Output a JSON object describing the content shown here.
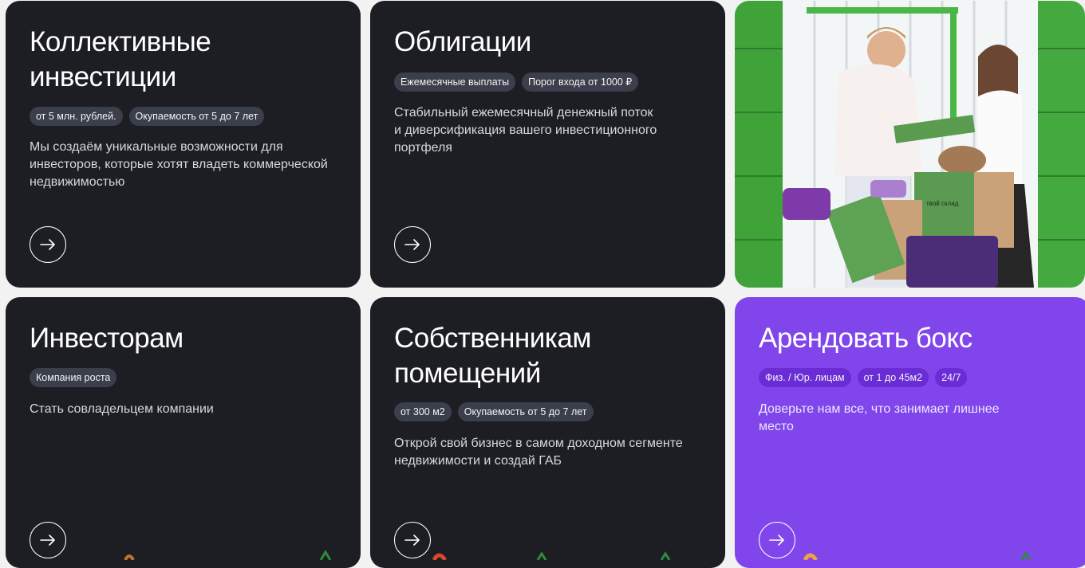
{
  "cards": [
    {
      "title": "Коллективные\nинвестиции",
      "tags": [
        "от 5 млн. рублей.",
        "Окупаемость от 5 до 7 лет"
      ],
      "description": "Мы создаём уникальные возможности для\nинвесторов, которые хотят владеть коммерческой\nнедвижимостью"
    },
    {
      "title": "Облигации",
      "tags": [
        "Ежемесячные выплаты",
        "Порог входа от 1000 ₽"
      ],
      "description": "Стабильный ежемесячный денежный поток\nи диверсификация вашего инвестиционного\nпортфеля"
    },
    {
      "title": "Инвесторам",
      "tags": [
        "Компания роста"
      ],
      "description": "Стать совладельцем компании"
    },
    {
      "title": "Собственникам\nпомещений",
      "tags": [
        "от 300 м2",
        "Окупаемость от 5 до 7 лет"
      ],
      "description": "Открой свой бизнес в самом доходном сегменте\nнедвижимости и создай ГАБ"
    },
    {
      "title": "Арендовать бокс",
      "tags": [
        "Физ. / Юр. лицам",
        "от 1 до 45м2",
        "24/7"
      ],
      "description": "Доверьте нам все, что занимает лишнее\nместо"
    }
  ],
  "photo": {
    "box_label": "твой склад"
  },
  "colors": {
    "card_dark": "#1c1e24",
    "card_accent": "#8046ec",
    "tag_dark": "#3b3f4b",
    "tag_accent": "#6a2cd4"
  }
}
